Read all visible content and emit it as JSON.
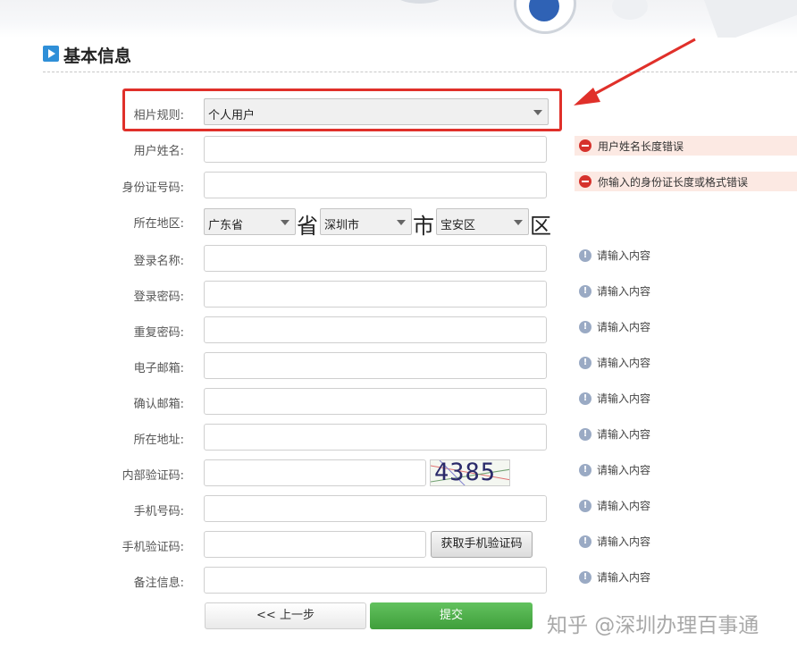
{
  "section": {
    "title": "基本信息"
  },
  "form": {
    "account_type": {
      "label": "相片规则:",
      "value": "个人用户"
    },
    "fields": [
      {
        "key": "name",
        "label": "用户姓名:",
        "value": "",
        "status": "error",
        "hint": "用户姓名长度错误"
      },
      {
        "key": "id",
        "label": "身份证号码:",
        "value": "",
        "status": "error",
        "hint": "你输入的身份证长度或格式错误"
      },
      {
        "key": "login",
        "label": "登录名称:",
        "value": "",
        "status": "info",
        "hint": "请输入内容"
      },
      {
        "key": "password",
        "label": "登录密码:",
        "value": "",
        "status": "info",
        "hint": "请输入内容"
      },
      {
        "key": "password2",
        "label": "重复密码:",
        "value": "",
        "status": "info",
        "hint": "请输入内容"
      },
      {
        "key": "email",
        "label": "电子邮箱:",
        "value": "",
        "status": "info",
        "hint": "请输入内容"
      },
      {
        "key": "email2",
        "label": "确认邮箱:",
        "value": "",
        "status": "info",
        "hint": "请输入内容"
      },
      {
        "key": "address",
        "label": "所在地址:",
        "value": "",
        "status": "info",
        "hint": "请输入内容"
      },
      {
        "key": "captcha",
        "label": "内部验证码:",
        "value": "",
        "status": "info",
        "hint": "请输入内容"
      },
      {
        "key": "phone",
        "label": "手机号码:",
        "value": "",
        "status": "info",
        "hint": "请输入内容"
      },
      {
        "key": "sms",
        "label": "手机验证码:",
        "value": "",
        "status": "info",
        "hint": "请输入内容"
      },
      {
        "key": "remark",
        "label": "备注信息:",
        "value": "",
        "status": "info",
        "hint": "请输入内容"
      }
    ],
    "region": {
      "label": "所在地区:",
      "province": "广东省",
      "province_unit": "省",
      "city": "深圳市",
      "city_unit": "市",
      "district": "宝安区",
      "district_unit": "区"
    },
    "captcha_image_text": "4385",
    "get_sms_code_label": "获取手机验证码",
    "prev_label": "<< 上一步",
    "submit_label": "提交"
  },
  "watermark": "知乎 @深圳办理百事通",
  "colors": {
    "highlight": "#e0302a",
    "submit": "#4caf50",
    "error_bg": "#fce9e3",
    "section_icon": "#2f8fd8"
  }
}
